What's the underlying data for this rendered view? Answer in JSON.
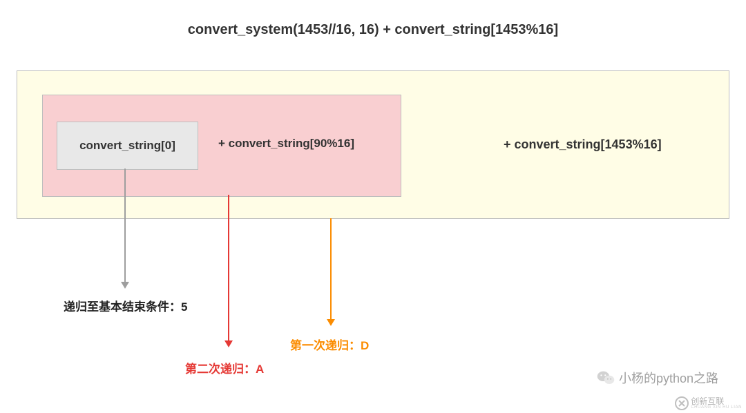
{
  "title": "convert_system(1453//16, 16) + convert_string[1453%16]",
  "outer": {
    "text": "+ convert_string[1453%16]"
  },
  "pink": {
    "text": "+ convert_string[90%16]"
  },
  "gray": {
    "text": "convert_string[0]"
  },
  "labels": {
    "gray": "递归至基本结束条件：5",
    "red": "第二次递归：A",
    "orange": "第一次递归：D"
  },
  "wechat": {
    "text": "小杨的python之路"
  },
  "corner": {
    "main": "创新互联",
    "sub": "CHUANG XIN HU LIAN"
  }
}
